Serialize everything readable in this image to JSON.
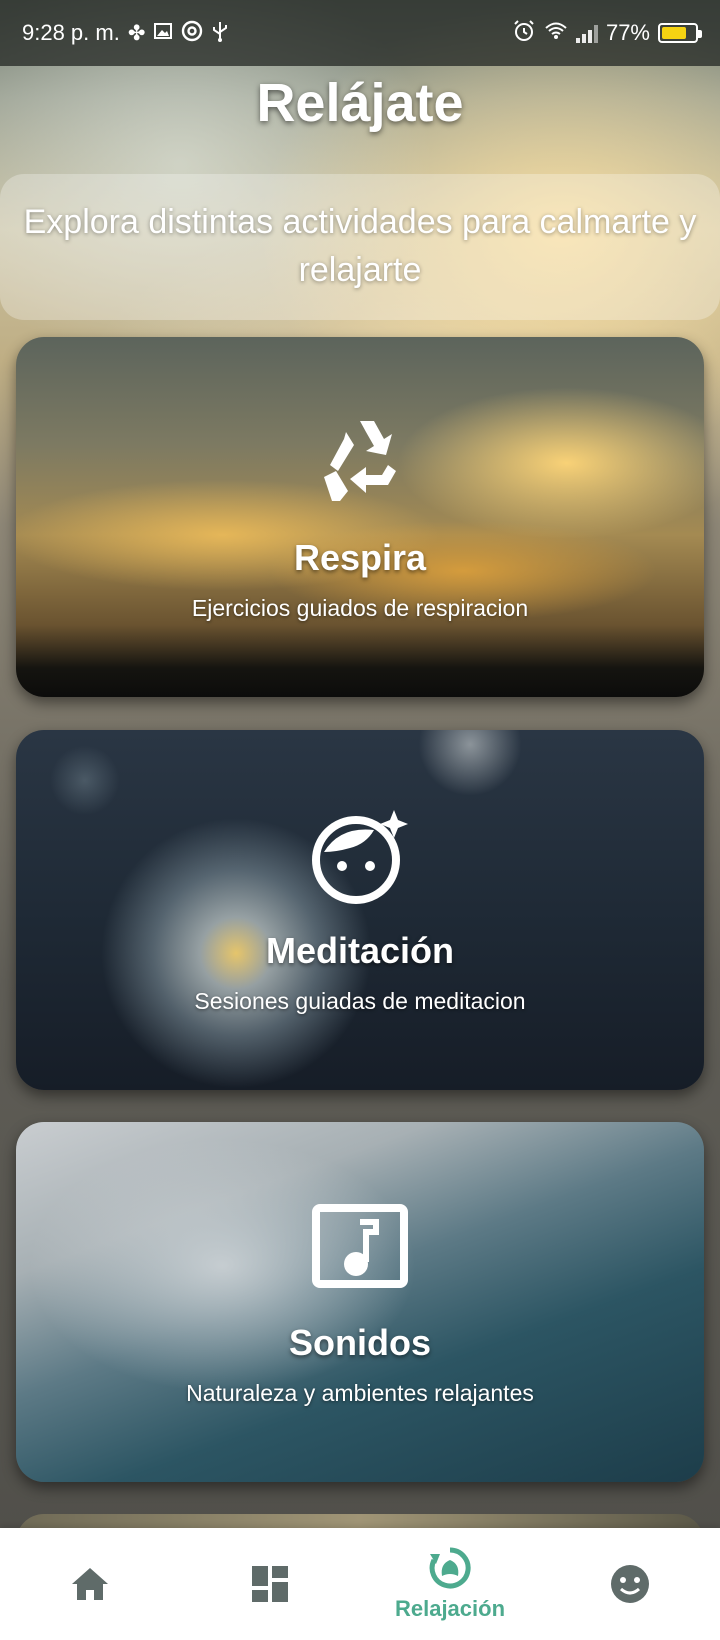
{
  "status_bar": {
    "time": "9:28 p. m.",
    "battery_percent": "77%",
    "battery_level": 0.77,
    "battery_color": "#f5d312",
    "icons_left": [
      "fan-icon",
      "image-icon",
      "at-sign-icon",
      "usb-icon"
    ],
    "icons_right": [
      "alarm-icon",
      "wifi-icon",
      "signal-icon",
      "battery-charging-icon"
    ]
  },
  "header": {
    "title": "Relájate",
    "subtitle": "Explora distintas actividades para calmarte y relajarte"
  },
  "cards": [
    {
      "title": "Respira",
      "subtitle": "Ejercicios guiados de respiracion",
      "icon": "recycle-icon"
    },
    {
      "title": "Meditación",
      "subtitle": "Sesiones guiadas de meditacion",
      "icon": "face-sparkle-icon"
    },
    {
      "title": "Sonidos",
      "subtitle": "Naturaleza y ambientes relajantes",
      "icon": "music-note-icon"
    }
  ],
  "bottom_nav": {
    "items": [
      {
        "icon": "home-icon",
        "label": "",
        "active": false
      },
      {
        "icon": "dashboard-icon",
        "label": "",
        "active": false
      },
      {
        "icon": "spa-refresh-icon",
        "label": "Relajación",
        "active": true
      },
      {
        "icon": "smiley-icon",
        "label": "",
        "active": false
      }
    ],
    "active_color": "#4daa8e",
    "inactive_color": "#5f6b69"
  }
}
